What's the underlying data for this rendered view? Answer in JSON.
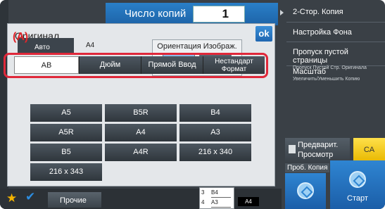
{
  "copies": {
    "label": "Число копий",
    "value": "1"
  },
  "dialog": {
    "title": "Оригинал",
    "ok_label": "ok",
    "orientation_label": "Ориентация Изображ.",
    "auto_label": "Авто",
    "auto_value": "A4",
    "marker": "(A)",
    "tabs": [
      {
        "label": "AB",
        "active": true
      },
      {
        "label": "Дюйм"
      },
      {
        "label": "Прямой Ввод"
      },
      {
        "label": "Нестандарт Формат"
      }
    ],
    "sizes": [
      "A5",
      "B5R",
      "B4",
      "A5R",
      "A4",
      "A3",
      "B5",
      "A4R",
      "216 x 340",
      "216 x 343"
    ]
  },
  "right_panel": {
    "items": [
      {
        "title": "2-Стор. Копия",
        "sub": ""
      },
      {
        "title": "Настройка Фона",
        "sub": ""
      },
      {
        "title": "Пропуск пустой страницы",
        "sub": "Пропуск Пустой Стр. Оригинала"
      },
      {
        "title": "Масштаб",
        "sub": "Увеличить/Уменьшить Копию"
      }
    ],
    "preview_label": "Предварит. Просмотр",
    "ca_label": "CA",
    "probe_label": "Проб. Копия",
    "start_label": "Старт"
  },
  "bottom": {
    "other_label": "Прочие",
    "tray": [
      {
        "num": "3",
        "size": "B4"
      },
      {
        "num": "4",
        "size": "A3"
      }
    ],
    "chip": "A4"
  },
  "colors": {
    "accent_blue": "#1f66b0",
    "marker_red": "#e1252b",
    "ca_yellow": "#ffe04a"
  }
}
